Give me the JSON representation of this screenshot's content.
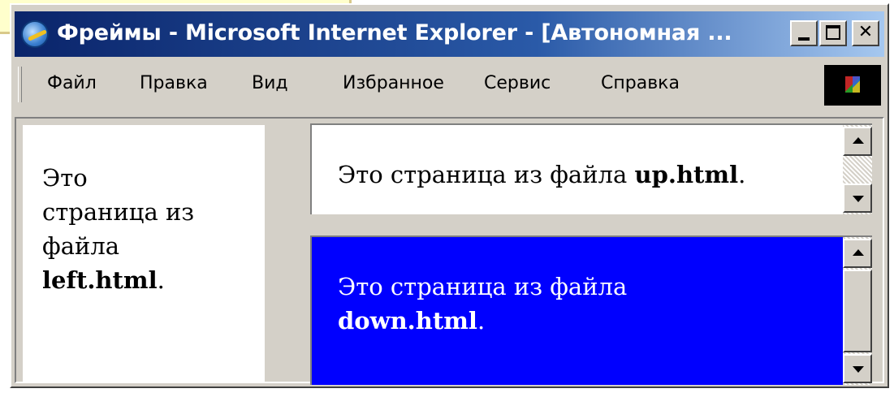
{
  "window": {
    "title": "Фреймы - Microsoft Internet Explorer - [Автономная ..."
  },
  "menu": {
    "items": [
      {
        "label": "Файл"
      },
      {
        "label": "Правка"
      },
      {
        "label": "Вид"
      },
      {
        "label": "Избранное"
      },
      {
        "label": "Сервис"
      },
      {
        "label": "Справка"
      }
    ]
  },
  "frames": {
    "left": {
      "text_lines": [
        "Это",
        "страница из",
        "файла"
      ],
      "filename": "left.html",
      "suffix": ".",
      "background": "#ffffff"
    },
    "up": {
      "prefix": "Это страница из файла ",
      "filename": "up.html",
      "suffix": ".",
      "background": "#ffffff"
    },
    "down": {
      "prefix": "Это страница из файла",
      "filename": "down.html",
      "suffix": ".",
      "background": "#0000ff"
    }
  },
  "icons": {
    "app": "internet-explorer-icon",
    "minimize": "minimize-icon",
    "maximize": "maximize-icon",
    "close": "close-icon",
    "throbber": "windows-logo-icon",
    "scroll_up": "arrow-up-icon",
    "scroll_down": "arrow-down-icon"
  },
  "colors": {
    "titlebar_start": "#0a246a",
    "titlebar_end": "#a6c8f0",
    "chrome": "#d4d0c8",
    "down_frame_bg": "#0000ff"
  }
}
